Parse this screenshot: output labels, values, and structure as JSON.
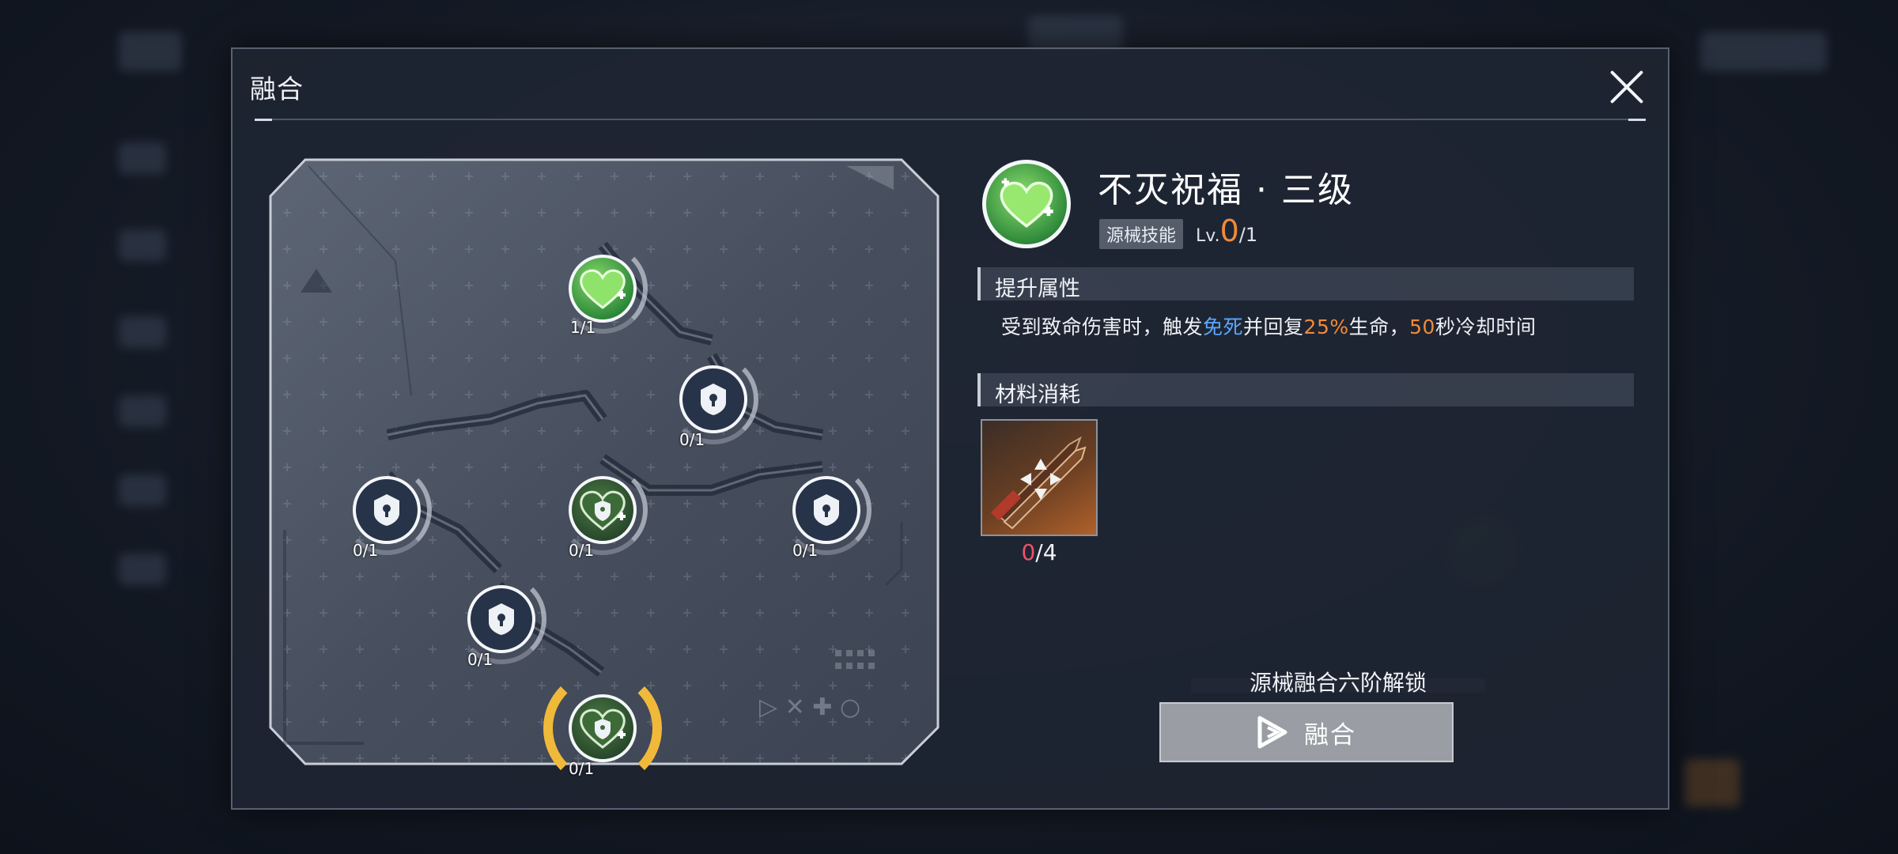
{
  "dialog": {
    "title": "融合",
    "close_icon": "close-icon"
  },
  "tree": {
    "nodes": [
      {
        "id": "top",
        "icon": "heart-icon",
        "level": "1/1",
        "state": "owned"
      },
      {
        "id": "upper-right",
        "icon": "shield-icon",
        "level": "0/1",
        "state": "locked"
      },
      {
        "id": "left",
        "icon": "shield-icon",
        "level": "0/1",
        "state": "locked"
      },
      {
        "id": "center",
        "icon": "heart-icon",
        "level": "0/1",
        "state": "available"
      },
      {
        "id": "right",
        "icon": "shield-icon",
        "level": "0/1",
        "state": "locked"
      },
      {
        "id": "lower-left",
        "icon": "shield-icon",
        "level": "0/1",
        "state": "locked"
      },
      {
        "id": "bottom",
        "icon": "heart-icon",
        "level": "0/1",
        "state": "selected"
      }
    ]
  },
  "skill": {
    "name": "不灭祝福 · 三级",
    "tag": "源械技能",
    "level_prefix": "Lv.",
    "level_current": "0",
    "level_max": "/1",
    "icon": "heart-icon"
  },
  "attributes": {
    "header": "提升属性",
    "desc_parts": {
      "p1": "受到致命伤害时，触发",
      "highlight1": "免死",
      "p2": "并回复",
      "highlight2": "25%",
      "p3": "生命，",
      "highlight3": "50",
      "p4": "秒冷却时间"
    }
  },
  "materials": {
    "header": "材料消耗",
    "items": [
      {
        "icon": "crossed-blades-icon",
        "have": "0",
        "need": "/4"
      }
    ]
  },
  "footer": {
    "unlock_text": "源械融合六阶解锁",
    "fuse_label": "融合",
    "fuse_icon": "play-icon"
  },
  "colors": {
    "accent_orange": "#f08a3a",
    "accent_blue": "#5aa8ff",
    "selection_gold": "#f1b93a",
    "heart_green": "#6ecf57"
  }
}
